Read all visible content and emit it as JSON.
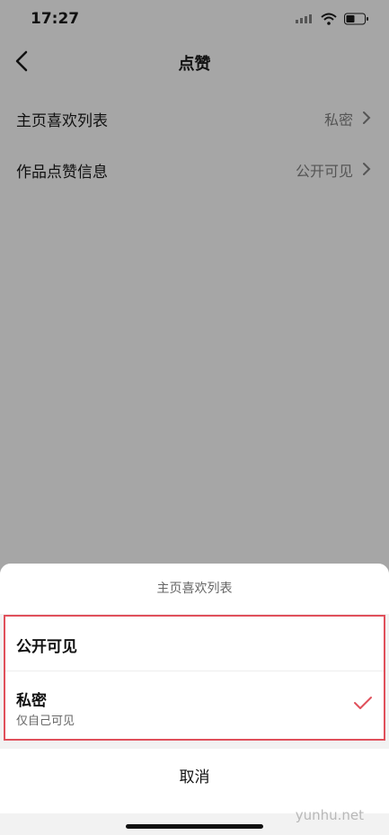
{
  "status": {
    "time": "17:27"
  },
  "nav": {
    "title": "点赞"
  },
  "settings": [
    {
      "label": "主页喜欢列表",
      "value": "私密"
    },
    {
      "label": "作品点赞信息",
      "value": "公开可见"
    }
  ],
  "sheet": {
    "title": "主页喜欢列表",
    "options": [
      {
        "label": "公开可见"
      },
      {
        "label": "私密",
        "sublabel": "仅自己可见",
        "selected": true
      }
    ],
    "cancel": "取消"
  },
  "watermark": "yunhu.net",
  "colors": {
    "overlay": "#a6a6a6",
    "check": "#e0505b",
    "highlight_border": "#e0505b"
  }
}
